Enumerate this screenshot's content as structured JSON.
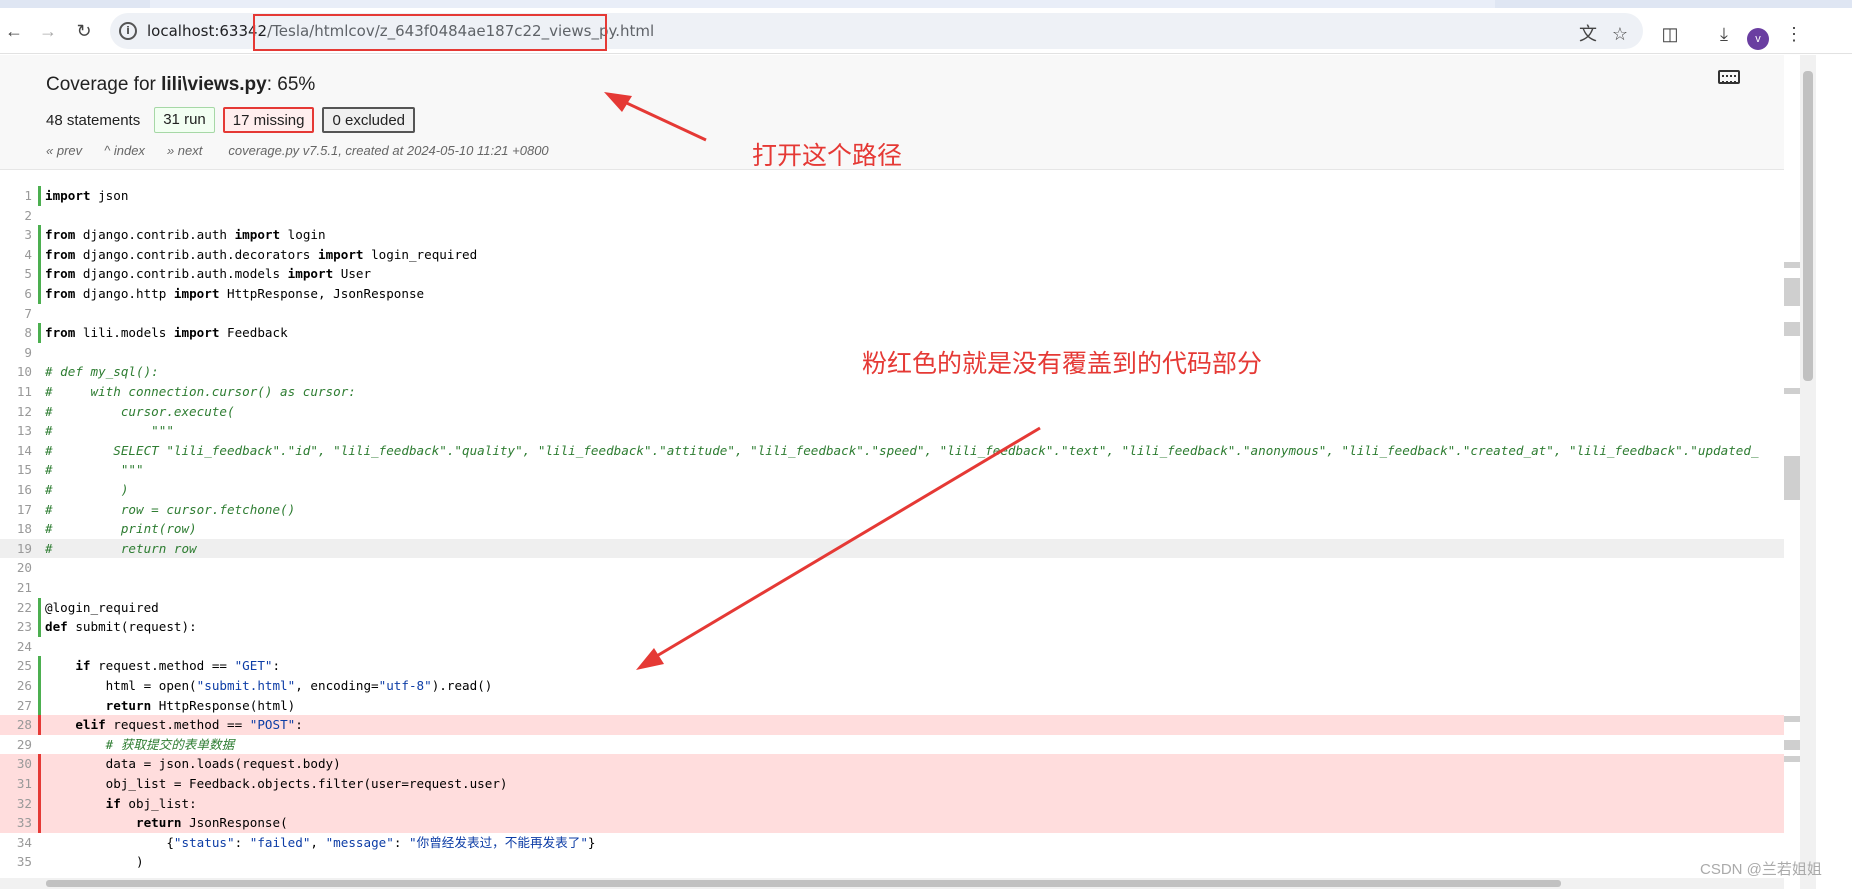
{
  "browser": {
    "url_host": "localhost:63342",
    "url_path": "/Tesla/htmlcov/z_643f0484ae187c22_views_py.html",
    "avatar_letter": "v",
    "icons": [
      "back-arrow-icon",
      "forward-arrow-icon",
      "reload-icon",
      "site-info-icon",
      "translate-icon",
      "star-icon",
      "extensions-icon",
      "download-icon",
      "avatar",
      "more-menu-icon"
    ]
  },
  "coverage": {
    "title_prefix": "Coverage for ",
    "file": "lili\\views.py",
    "title_suffix": ": 65%",
    "statements": "48 statements",
    "run": "31 run",
    "missing": "17 missing",
    "excluded": "0 excluded",
    "prev": "« prev",
    "index": "^ index",
    "next": "» next",
    "created": "coverage.py v7.5.1, created at 2024-05-10 11:21 +0800"
  },
  "annotations": {
    "open_path": "打开这个路径",
    "pink_note": "粉红色的就是没有覆盖到的代码部分",
    "colors": {
      "red": "#e53935",
      "missing_bg": "#ffdddd",
      "run_bar": "#4caf50"
    }
  },
  "watermark": "CSDN @兰若姐姐",
  "source_lines": [
    {
      "n": "1",
      "cls": "run",
      "html": "<span class='kw'>import</span> json"
    },
    {
      "n": "2",
      "cls": "",
      "html": ""
    },
    {
      "n": "3",
      "cls": "run",
      "html": "<span class='kw'>from</span> django.contrib.auth <span class='kw'>import</span> login"
    },
    {
      "n": "4",
      "cls": "run",
      "html": "<span class='kw'>from</span> django.contrib.auth.decorators <span class='kw'>import</span> login_required"
    },
    {
      "n": "5",
      "cls": "run",
      "html": "<span class='kw'>from</span> django.contrib.auth.models <span class='kw'>import</span> User"
    },
    {
      "n": "6",
      "cls": "run",
      "html": "<span class='kw'>from</span> django.http <span class='kw'>import</span> HttpResponse, JsonResponse"
    },
    {
      "n": "7",
      "cls": "",
      "html": ""
    },
    {
      "n": "8",
      "cls": "run",
      "html": "<span class='kw'>from</span> lili.models <span class='kw'>import</span> Feedback"
    },
    {
      "n": "9",
      "cls": "",
      "html": ""
    },
    {
      "n": "10",
      "cls": "",
      "html": "<span class='com'># def my_sql():</span>"
    },
    {
      "n": "11",
      "cls": "",
      "html": "<span class='com'>#     with connection.cursor() as cursor:</span>"
    },
    {
      "n": "12",
      "cls": "",
      "html": "<span class='com'>#         cursor.execute(</span>"
    },
    {
      "n": "13",
      "cls": "",
      "html": "<span class='com'>#             \"\"\"</span>"
    },
    {
      "n": "14",
      "cls": "",
      "html": "<span class='com'>#        SELECT \"lili_feedback\".\"id\", \"lili_feedback\".\"quality\", \"lili_feedback\".\"attitude\", \"lili_feedback\".\"speed\", \"lili_feedback\".\"text\", \"lili_feedback\".\"anonymous\", \"lili_feedback\".\"created_at\", \"lili_feedback\".\"updated_</span>"
    },
    {
      "n": "15",
      "cls": "",
      "html": "<span class='com'>#         \"\"\"</span>"
    },
    {
      "n": "16",
      "cls": "",
      "html": "<span class='com'>#         )</span>"
    },
    {
      "n": "17",
      "cls": "",
      "html": "<span class='com'>#         row = cursor.fetchone()</span>"
    },
    {
      "n": "18",
      "cls": "",
      "html": "<span class='com'>#         print(row)</span>"
    },
    {
      "n": "19",
      "cls": "hl",
      "html": "<span class='com'>#         return row</span>"
    },
    {
      "n": "20",
      "cls": "",
      "html": ""
    },
    {
      "n": "21",
      "cls": "",
      "html": ""
    },
    {
      "n": "22",
      "cls": "run",
      "html": "@login_required"
    },
    {
      "n": "23",
      "cls": "run",
      "html": "<span class='kw'>def</span> submit(request):"
    },
    {
      "n": "24",
      "cls": "",
      "html": ""
    },
    {
      "n": "25",
      "cls": "run",
      "html": "    <span class='kw'>if</span> request.method == <span class='str'>\"GET\"</span>:"
    },
    {
      "n": "26",
      "cls": "run",
      "html": "        html = open(<span class='str'>\"submit.html\"</span>, encoding=<span class='str'>\"utf-8\"</span>).read()"
    },
    {
      "n": "27",
      "cls": "run",
      "html": "        <span class='kw'>return</span> HttpResponse(html)"
    },
    {
      "n": "28",
      "cls": "mis",
      "html": "    <span class='kw'>elif</span> request.method == <span class='str'>\"POST\"</span>:"
    },
    {
      "n": "29",
      "cls": "",
      "html": "        <span class='com'># 获取提交的表单数据</span>"
    },
    {
      "n": "30",
      "cls": "mis",
      "html": "        data = json.loads(request.body)"
    },
    {
      "n": "31",
      "cls": "mis",
      "html": "        obj_list = Feedback.objects.filter(user=request.user)"
    },
    {
      "n": "32",
      "cls": "mis",
      "html": "        <span class='kw'>if</span> obj_list:"
    },
    {
      "n": "33",
      "cls": "mis",
      "html": "            <span class='kw'>return</span> JsonResponse("
    },
    {
      "n": "34",
      "cls": "",
      "html": "                {<span class='str'>\"status\"</span>: <span class='str'>\"failed\"</span>, <span class='str'>\"message\"</span>: <span class='str'>\"你曾经发表过，不能再发表了\"</span>}"
    },
    {
      "n": "35",
      "cls": "",
      "html": "            )"
    }
  ]
}
